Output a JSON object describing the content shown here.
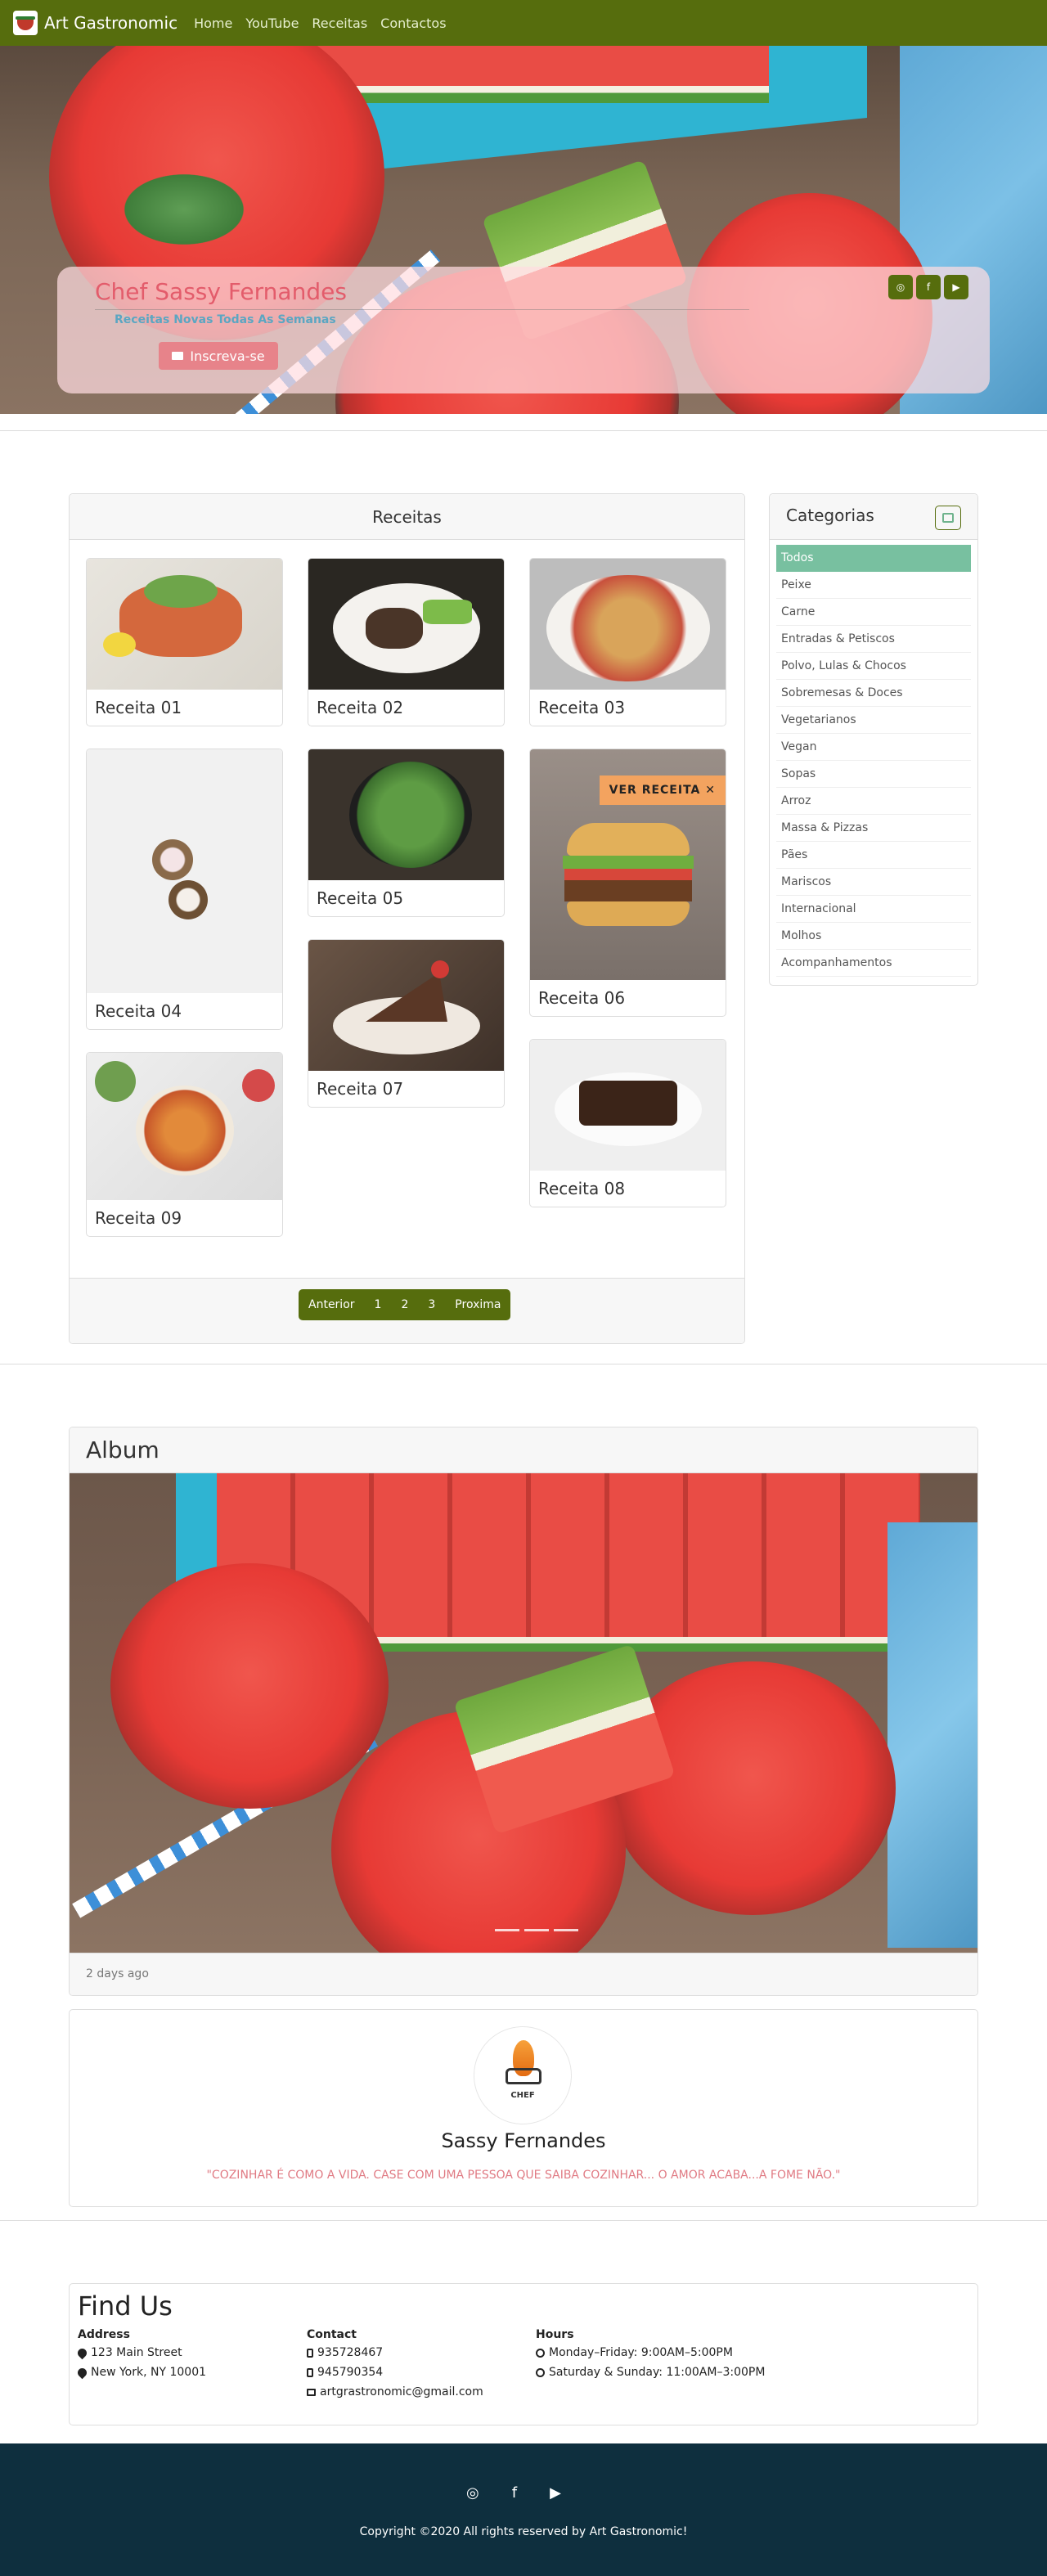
{
  "navbar": {
    "brand": "Art Gastronomic",
    "links": [
      "Home",
      "YouTube",
      "Receitas",
      "Contactos"
    ]
  },
  "hero": {
    "title": "Chef Sassy Fernandes",
    "subtitle": "Receitas Novas Todas As Semanas",
    "subscribe_label": "Inscreva-se",
    "social_icons": [
      "instagram-icon",
      "facebook-icon",
      "youtube-icon"
    ]
  },
  "recipes": {
    "title": "Receitas",
    "cards": [
      {
        "label": "Receita 01"
      },
      {
        "label": "Receita 02"
      },
      {
        "label": "Receita 03"
      },
      {
        "label": "Receita 04"
      },
      {
        "label": "Receita 05"
      },
      {
        "label": "Receita 06",
        "badge": "VER RECEITA"
      },
      {
        "label": "Receita 07"
      },
      {
        "label": "Receita 08"
      },
      {
        "label": "Receita 09"
      }
    ],
    "pagination": [
      "Anterior",
      "1",
      "2",
      "3",
      "Proxima"
    ]
  },
  "categories": {
    "title": "Categorias",
    "items": [
      "Todos",
      "Peixe",
      "Carne",
      "Entradas & Petiscos",
      "Polvo, Lulas & Chocos",
      "Sobremesas & Doces",
      "Vegetarianos",
      "Vegan",
      "Sopas",
      "Arroz",
      "Massa & Pizzas",
      "Pães",
      "Mariscos",
      "Internacional",
      "Molhos",
      "Acompanhamentos"
    ],
    "active": "Todos"
  },
  "album": {
    "title": "Album",
    "timestamp": "2 days ago"
  },
  "profile": {
    "logo_text": "CHEF",
    "name": "Sassy Fernandes",
    "quote": "\"COZINHAR É COMO A VIDA. CASE COM UMA PESSOA QUE SAIBA COZINHAR... O AMOR ACABA...A FOME NÃO.\""
  },
  "find_us": {
    "title": "Find Us",
    "address": {
      "heading": "Address",
      "lines": [
        "123 Main Street",
        "New York, NY 10001"
      ]
    },
    "contact": {
      "heading": "Contact",
      "phone1": "935728467",
      "phone2": "945790354",
      "email": "artgrastronomic@gmail.com"
    },
    "hours": {
      "heading": "Hours",
      "lines": [
        "Monday–Friday: 9:00AM–5:00PM",
        "Saturday & Sunday: 11:00AM–3:00PM"
      ]
    }
  },
  "footer": {
    "social_icons": [
      "instagram-icon",
      "facebook-icon",
      "youtube-icon"
    ],
    "copyright": "Copyright ©2020 All rights reserved by Art Gastronomic!"
  },
  "colors": {
    "navbar": "#566d0d",
    "hero_title": "#e35c6b",
    "category_active": "#78c0a0",
    "badge": "#f3a35f",
    "footer": "#0e2f3e"
  }
}
